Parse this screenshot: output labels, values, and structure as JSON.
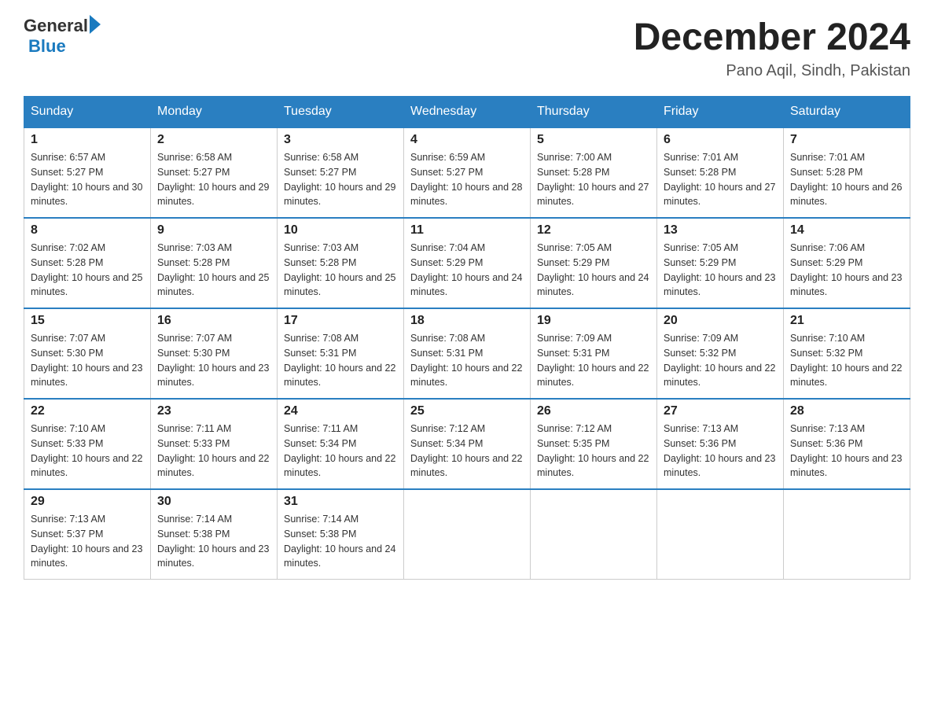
{
  "header": {
    "logo": {
      "general": "General",
      "blue": "Blue"
    },
    "title": "December 2024",
    "location": "Pano Aqil, Sindh, Pakistan"
  },
  "weekdays": [
    "Sunday",
    "Monday",
    "Tuesday",
    "Wednesday",
    "Thursday",
    "Friday",
    "Saturday"
  ],
  "weeks": [
    [
      {
        "day": "1",
        "sunrise": "6:57 AM",
        "sunset": "5:27 PM",
        "daylight": "10 hours and 30 minutes."
      },
      {
        "day": "2",
        "sunrise": "6:58 AM",
        "sunset": "5:27 PM",
        "daylight": "10 hours and 29 minutes."
      },
      {
        "day": "3",
        "sunrise": "6:58 AM",
        "sunset": "5:27 PM",
        "daylight": "10 hours and 29 minutes."
      },
      {
        "day": "4",
        "sunrise": "6:59 AM",
        "sunset": "5:27 PM",
        "daylight": "10 hours and 28 minutes."
      },
      {
        "day": "5",
        "sunrise": "7:00 AM",
        "sunset": "5:28 PM",
        "daylight": "10 hours and 27 minutes."
      },
      {
        "day": "6",
        "sunrise": "7:01 AM",
        "sunset": "5:28 PM",
        "daylight": "10 hours and 27 minutes."
      },
      {
        "day": "7",
        "sunrise": "7:01 AM",
        "sunset": "5:28 PM",
        "daylight": "10 hours and 26 minutes."
      }
    ],
    [
      {
        "day": "8",
        "sunrise": "7:02 AM",
        "sunset": "5:28 PM",
        "daylight": "10 hours and 25 minutes."
      },
      {
        "day": "9",
        "sunrise": "7:03 AM",
        "sunset": "5:28 PM",
        "daylight": "10 hours and 25 minutes."
      },
      {
        "day": "10",
        "sunrise": "7:03 AM",
        "sunset": "5:28 PM",
        "daylight": "10 hours and 25 minutes."
      },
      {
        "day": "11",
        "sunrise": "7:04 AM",
        "sunset": "5:29 PM",
        "daylight": "10 hours and 24 minutes."
      },
      {
        "day": "12",
        "sunrise": "7:05 AM",
        "sunset": "5:29 PM",
        "daylight": "10 hours and 24 minutes."
      },
      {
        "day": "13",
        "sunrise": "7:05 AM",
        "sunset": "5:29 PM",
        "daylight": "10 hours and 23 minutes."
      },
      {
        "day": "14",
        "sunrise": "7:06 AM",
        "sunset": "5:29 PM",
        "daylight": "10 hours and 23 minutes."
      }
    ],
    [
      {
        "day": "15",
        "sunrise": "7:07 AM",
        "sunset": "5:30 PM",
        "daylight": "10 hours and 23 minutes."
      },
      {
        "day": "16",
        "sunrise": "7:07 AM",
        "sunset": "5:30 PM",
        "daylight": "10 hours and 23 minutes."
      },
      {
        "day": "17",
        "sunrise": "7:08 AM",
        "sunset": "5:31 PM",
        "daylight": "10 hours and 22 minutes."
      },
      {
        "day": "18",
        "sunrise": "7:08 AM",
        "sunset": "5:31 PM",
        "daylight": "10 hours and 22 minutes."
      },
      {
        "day": "19",
        "sunrise": "7:09 AM",
        "sunset": "5:31 PM",
        "daylight": "10 hours and 22 minutes."
      },
      {
        "day": "20",
        "sunrise": "7:09 AM",
        "sunset": "5:32 PM",
        "daylight": "10 hours and 22 minutes."
      },
      {
        "day": "21",
        "sunrise": "7:10 AM",
        "sunset": "5:32 PM",
        "daylight": "10 hours and 22 minutes."
      }
    ],
    [
      {
        "day": "22",
        "sunrise": "7:10 AM",
        "sunset": "5:33 PM",
        "daylight": "10 hours and 22 minutes."
      },
      {
        "day": "23",
        "sunrise": "7:11 AM",
        "sunset": "5:33 PM",
        "daylight": "10 hours and 22 minutes."
      },
      {
        "day": "24",
        "sunrise": "7:11 AM",
        "sunset": "5:34 PM",
        "daylight": "10 hours and 22 minutes."
      },
      {
        "day": "25",
        "sunrise": "7:12 AM",
        "sunset": "5:34 PM",
        "daylight": "10 hours and 22 minutes."
      },
      {
        "day": "26",
        "sunrise": "7:12 AM",
        "sunset": "5:35 PM",
        "daylight": "10 hours and 22 minutes."
      },
      {
        "day": "27",
        "sunrise": "7:13 AM",
        "sunset": "5:36 PM",
        "daylight": "10 hours and 23 minutes."
      },
      {
        "day": "28",
        "sunrise": "7:13 AM",
        "sunset": "5:36 PM",
        "daylight": "10 hours and 23 minutes."
      }
    ],
    [
      {
        "day": "29",
        "sunrise": "7:13 AM",
        "sunset": "5:37 PM",
        "daylight": "10 hours and 23 minutes."
      },
      {
        "day": "30",
        "sunrise": "7:14 AM",
        "sunset": "5:38 PM",
        "daylight": "10 hours and 23 minutes."
      },
      {
        "day": "31",
        "sunrise": "7:14 AM",
        "sunset": "5:38 PM",
        "daylight": "10 hours and 24 minutes."
      },
      null,
      null,
      null,
      null
    ]
  ]
}
